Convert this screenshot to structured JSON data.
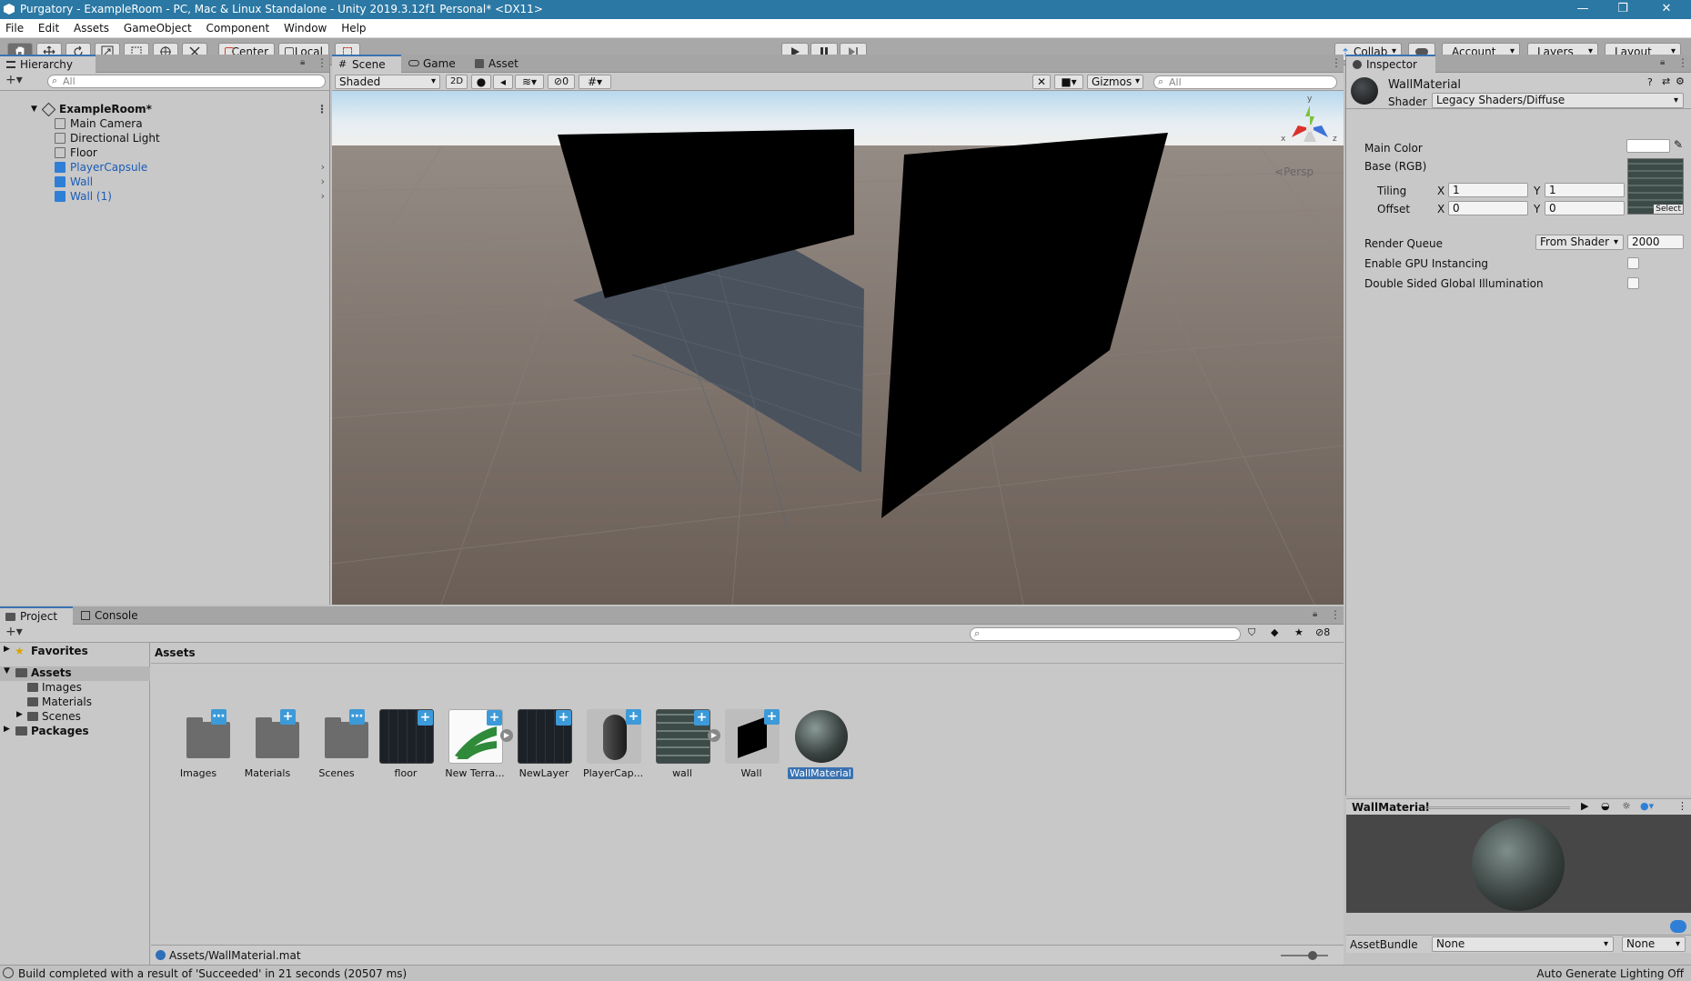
{
  "window": {
    "title": "Purgatory - ExampleRoom - PC, Mac & Linux Standalone - Unity 2019.3.12f1 Personal* <DX11>",
    "minimize": "—",
    "restore": "❐",
    "close": "✕"
  },
  "menu": [
    "File",
    "Edit",
    "Assets",
    "GameObject",
    "Component",
    "Window",
    "Help"
  ],
  "toolbar": {
    "pivot": "Center",
    "space": "Local",
    "collab": "Collab",
    "account": "Account",
    "layers": "Layers",
    "layout": "Layout"
  },
  "hierarchy": {
    "tab": "Hierarchy",
    "search_placeholder": "All",
    "scene_name": "ExampleRoom*",
    "items": [
      {
        "label": "Main Camera",
        "prefab": false
      },
      {
        "label": "Directional Light",
        "prefab": false
      },
      {
        "label": "Floor",
        "prefab": false
      },
      {
        "label": "PlayerCapsule",
        "prefab": true
      },
      {
        "label": "Wall",
        "prefab": true
      },
      {
        "label": "Wall (1)",
        "prefab": true
      }
    ]
  },
  "scene": {
    "tabs": [
      "Scene",
      "Game",
      "Asset Store"
    ],
    "shading": "Shaded",
    "mode_2d": "2D",
    "hidden_count": "0",
    "gizmos": "Gizmos",
    "search_placeholder": "All",
    "projection": "Persp",
    "axis": {
      "y": "y",
      "x": "x",
      "z": "z"
    }
  },
  "inspector": {
    "tab": "Inspector",
    "material_name": "WallMaterial",
    "shader_label": "Shader",
    "shader_value": "Legacy Shaders/Diffuse",
    "main_color_label": "Main Color",
    "base_label": "Base (RGB)",
    "tiling_label": "Tiling",
    "offset_label": "Offset",
    "tiling_x": "1",
    "tiling_y": "1",
    "offset_x": "0",
    "offset_y": "0",
    "x_label": "X",
    "y_label": "Y",
    "select_label": "Select",
    "render_queue_label": "Render Queue",
    "render_queue_mode": "From Shader",
    "render_queue_value": "2000",
    "gpu_instancing_label": "Enable GPU Instancing",
    "double_sided_gi_label": "Double Sided Global Illumination",
    "preview_title": "WallMaterial",
    "assetbundle_label": "AssetBundle",
    "assetbundle_value": "None",
    "assetbundle_variant": "None"
  },
  "project": {
    "tabs": [
      "Project",
      "Console"
    ],
    "hidden_count": "8",
    "tree": {
      "favorites": "Favorites",
      "assets": "Assets",
      "children": [
        "Images",
        "Materials",
        "Scenes"
      ],
      "packages": "Packages"
    },
    "breadcrumb": "Assets",
    "assets": [
      {
        "label": "Images",
        "kind": "folder"
      },
      {
        "label": "Materials",
        "kind": "folder"
      },
      {
        "label": "Scenes",
        "kind": "folder"
      },
      {
        "label": "floor",
        "kind": "texture-dark"
      },
      {
        "label": "New Terra...",
        "kind": "terrain"
      },
      {
        "label": "NewLayer",
        "kind": "texture-dark"
      },
      {
        "label": "PlayerCap...",
        "kind": "capsule"
      },
      {
        "label": "wall",
        "kind": "texture-stone"
      },
      {
        "label": "Wall",
        "kind": "wall-prefab"
      },
      {
        "label": "WallMaterial",
        "kind": "material",
        "selected": true
      }
    ],
    "selected_path": "Assets/WallMaterial.mat"
  },
  "status": {
    "message": "Build completed with a result of 'Succeeded' in 21 seconds (20507 ms)",
    "lighting": "Auto Generate Lighting Off"
  },
  "colors": {
    "titlebar": "#2b78a4",
    "accent": "#3a72b0",
    "prefab_blue": "#2f7fd6"
  }
}
